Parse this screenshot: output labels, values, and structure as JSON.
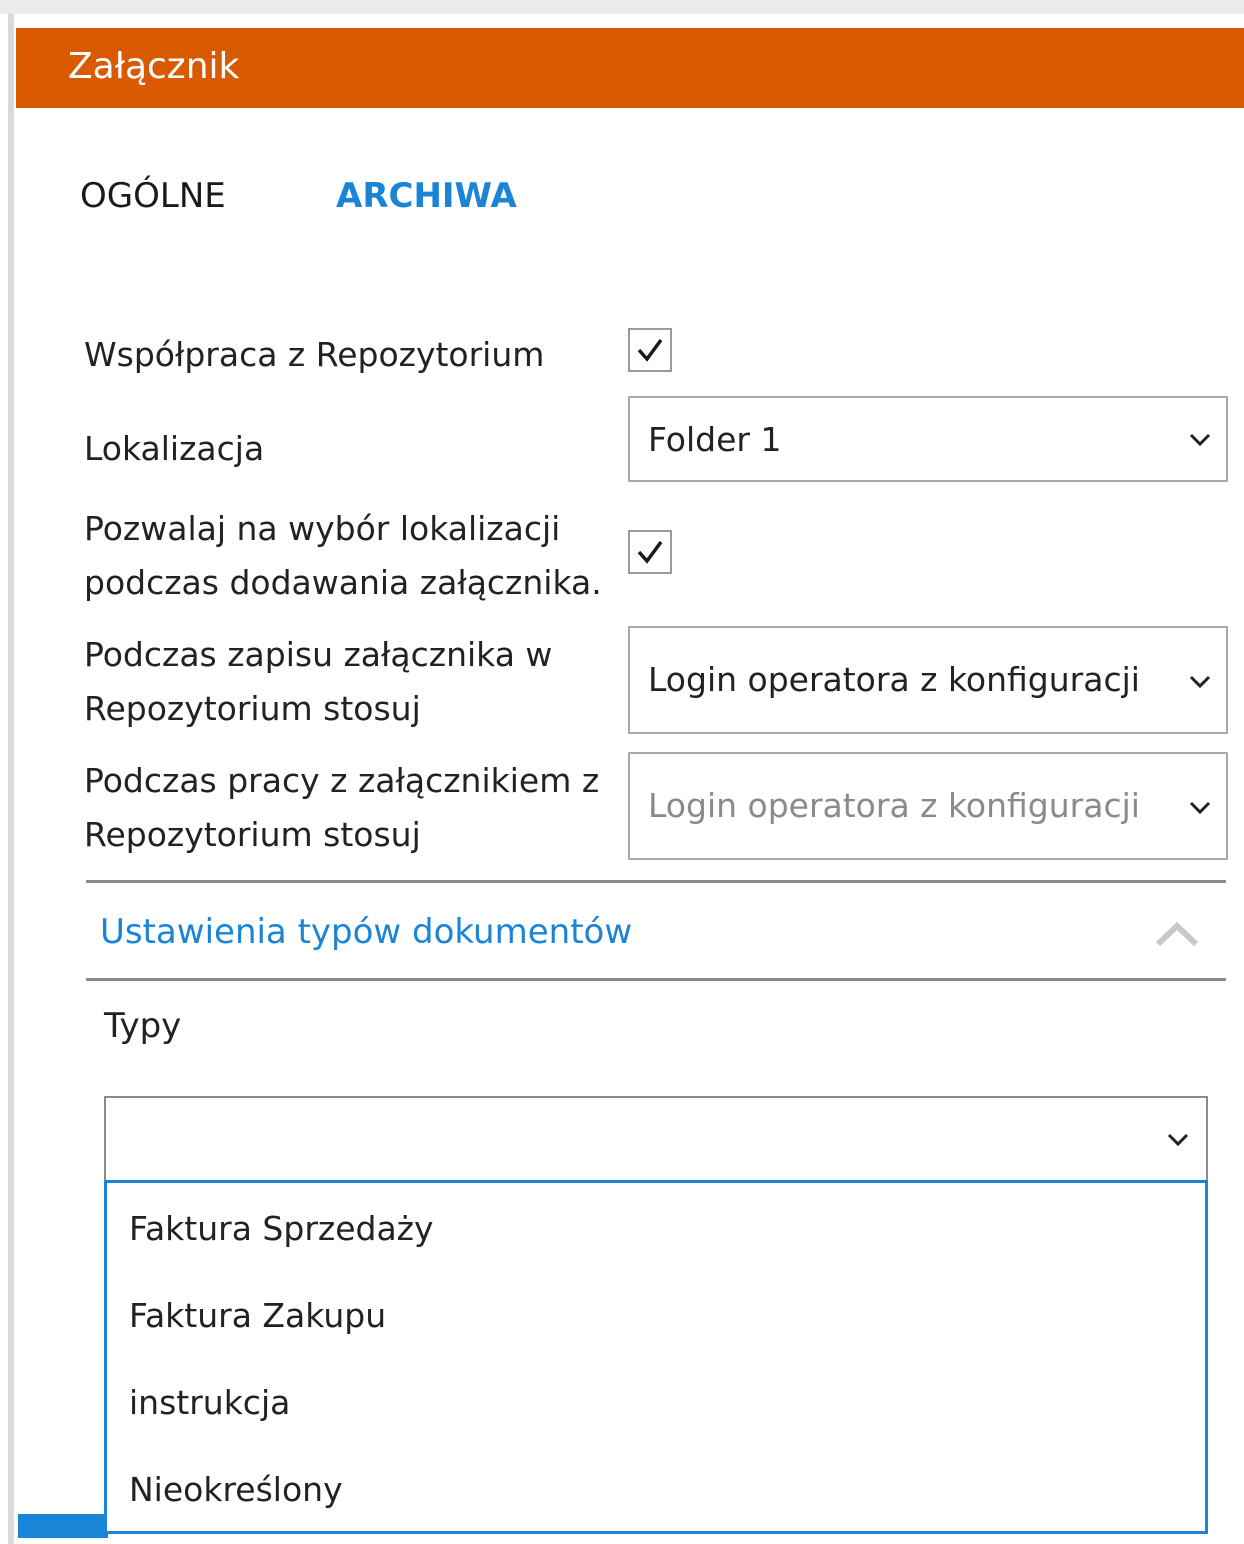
{
  "header": {
    "title": "Załącznik",
    "color": "#d95a00"
  },
  "tabs": [
    {
      "label": "OGÓLNE",
      "active": false
    },
    {
      "label": "ARCHIWA",
      "active": true
    }
  ],
  "form": {
    "repo_cooperation": {
      "label": "Współpraca z Repozytorium",
      "checked": true
    },
    "location": {
      "label": "Lokalizacja",
      "value": "Folder 1"
    },
    "allow_location_choice": {
      "label_line1": "Pozwalaj na wybór lokalizacji",
      "label_line2": "podczas dodawania załącznika.",
      "checked": true
    },
    "save_mode": {
      "label_line1": "Podczas zapisu załącznika w",
      "label_line2": "Repozytorium stosuj",
      "value": "Login operatora z konfiguracji"
    },
    "work_mode": {
      "label_line1": "Podczas pracy z załącznikiem z",
      "label_line2": "Repozytorium stosuj",
      "value": "Login operatora z konfiguracji",
      "disabled": true
    }
  },
  "doc_types_section": {
    "title": "Ustawienia typów dokumentów",
    "types_label": "Typy",
    "selected": "",
    "options": [
      "Faktura Sprzedaży",
      "Faktura Zakupu",
      "instrukcja",
      "Nieokreślony"
    ]
  },
  "colors": {
    "accent": "#1a84d6",
    "header": "#d95a00"
  }
}
